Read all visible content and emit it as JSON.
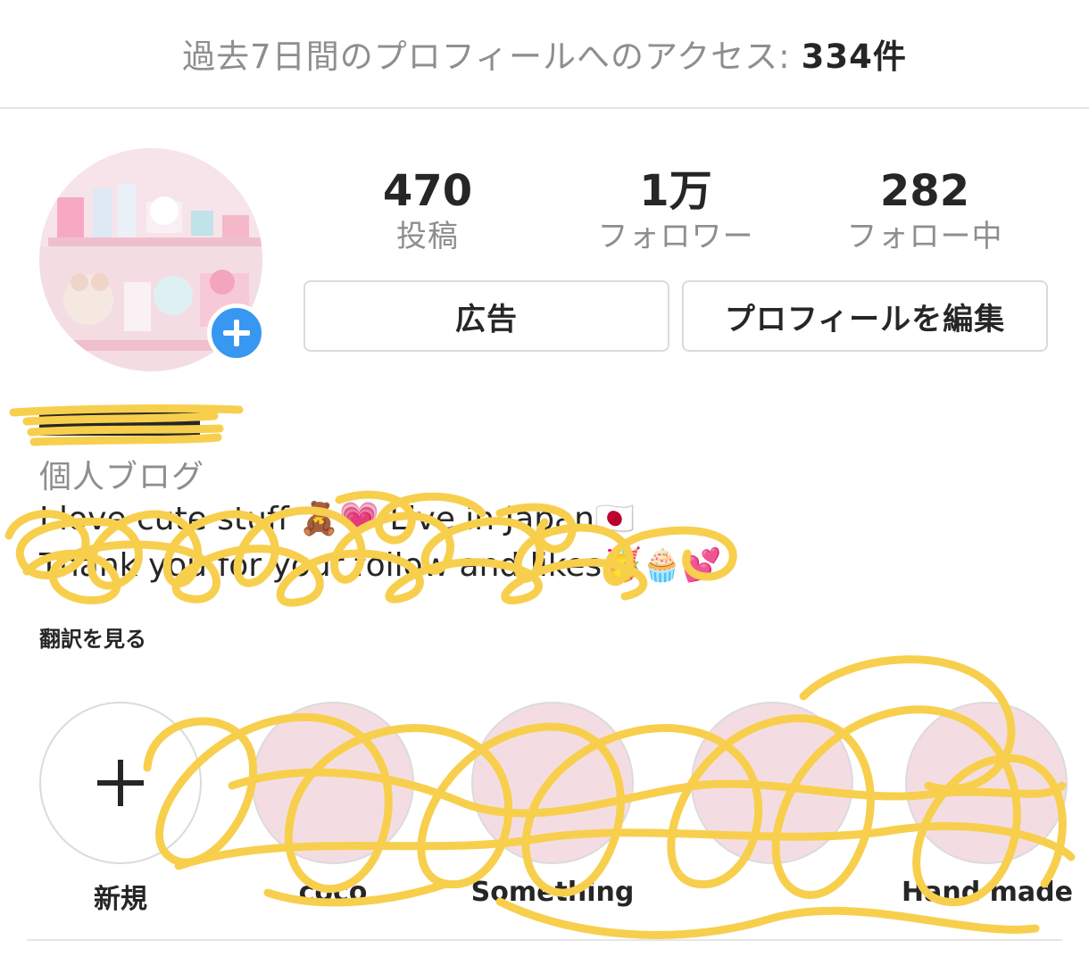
{
  "access_bar": {
    "label": "過去7日間のプロフィールへのアクセス:",
    "count": "334件"
  },
  "stats": [
    {
      "value": "470",
      "label": "投稿"
    },
    {
      "value": "1万",
      "label": "フォロワー"
    },
    {
      "value": "282",
      "label": "フォロー中"
    }
  ],
  "buttons": {
    "ads": "広告",
    "edit_profile": "プロフィールを編集"
  },
  "bio": {
    "category": "個人ブログ",
    "line1": "I love cute stuff 🧸💗 Live in Japan🇯🇵",
    "line2": "Thank you for your follow and likes🥳🧁💕",
    "translate": "翻訳を見る"
  },
  "highlights": [
    {
      "label": "新規",
      "icon": "plus-icon"
    },
    {
      "label": "coco"
    },
    {
      "label": "Something"
    },
    {
      "label": ""
    },
    {
      "label": "Hand made"
    }
  ],
  "colors": {
    "accent_blue": "#3897f0",
    "scribble_yellow": "#f7cf4d",
    "muted_text": "#8e8e8e",
    "border": "#dbdbdb"
  }
}
